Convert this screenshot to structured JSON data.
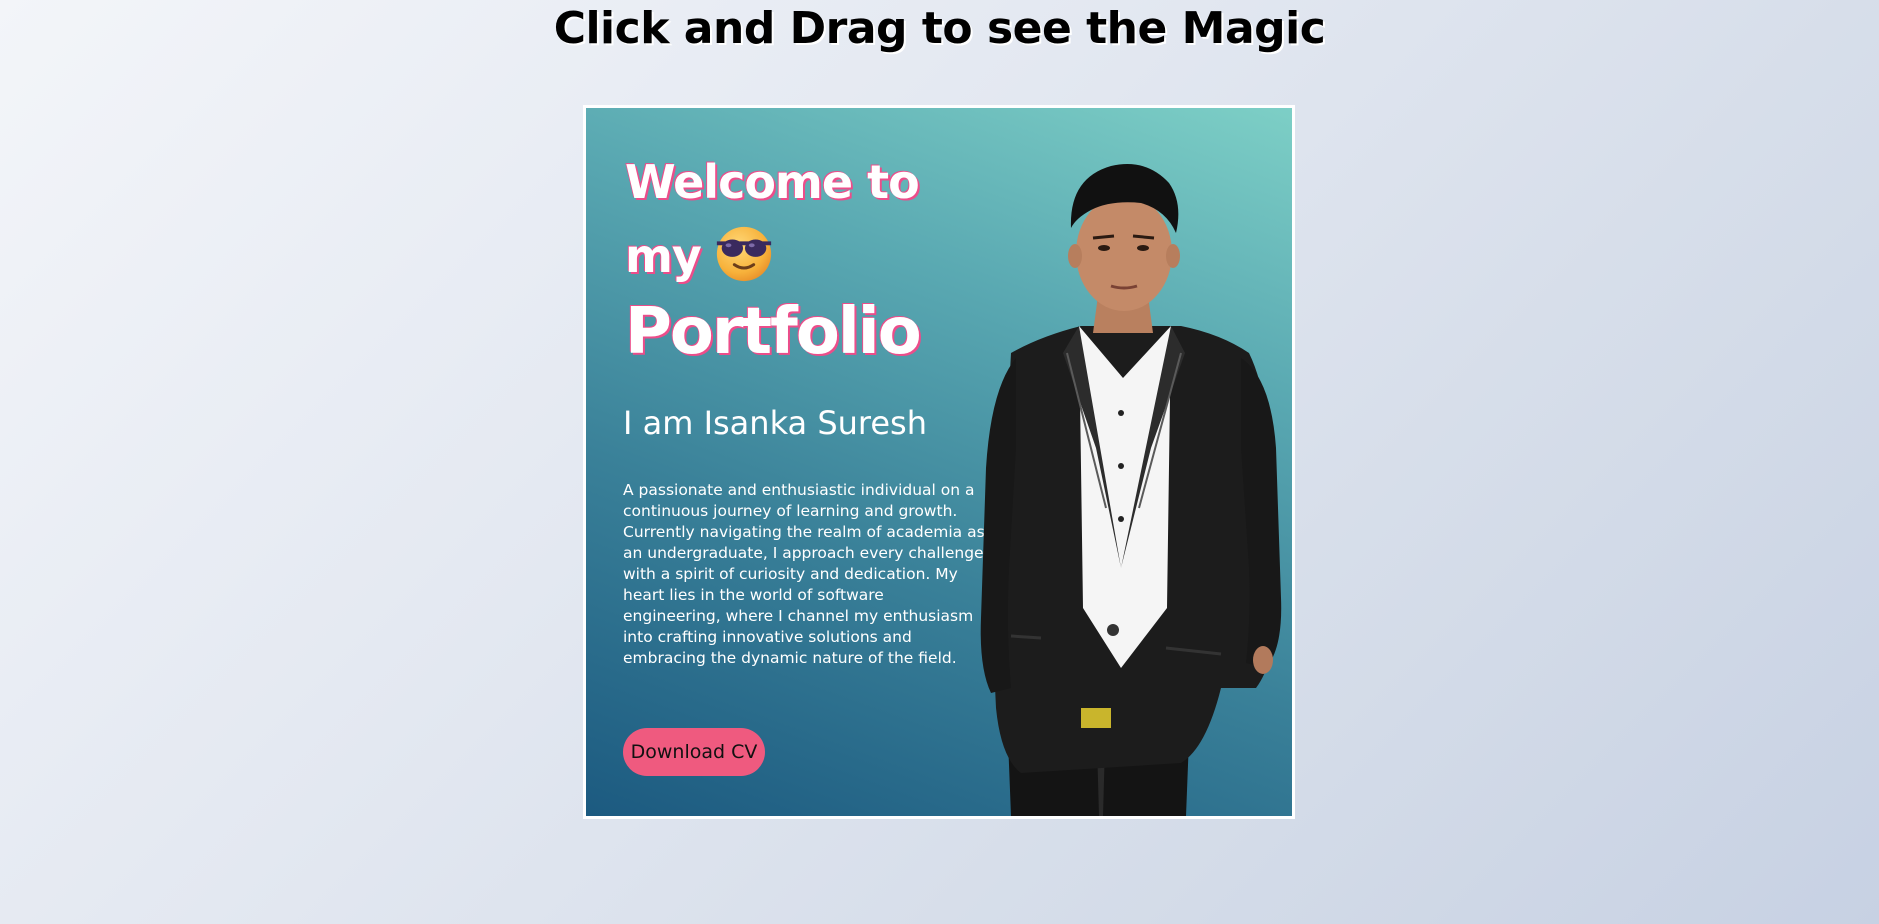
{
  "page": {
    "heading": "Click and Drag to see the Magic"
  },
  "card": {
    "welcome_line_1": "Welcome to",
    "welcome_line_2": "my",
    "welcome_line_3": "Portfolio",
    "emoji_icon": "smiling-face-with-sunglasses-icon",
    "name": "I am Isanka Suresh",
    "bio": "A passionate and enthusiastic individual on a continuous journey of learning and growth. Currently navigating the realm of academia as an undergraduate, I approach every challenge with a spirit of curiosity and dedication. My heart lies in the world of software engineering, where I channel my enthusiasm into crafting innovative solutions and embracing the dynamic nature of the field.",
    "download_label": "Download CV",
    "portrait_icon": "portrait-photo"
  },
  "colors": {
    "accent_pink": "#ef5a7f",
    "text_shadow_pink": "#ec4d8a",
    "card_gradient_top": "#7dcfc6",
    "card_gradient_bottom": "#1c5a80"
  }
}
